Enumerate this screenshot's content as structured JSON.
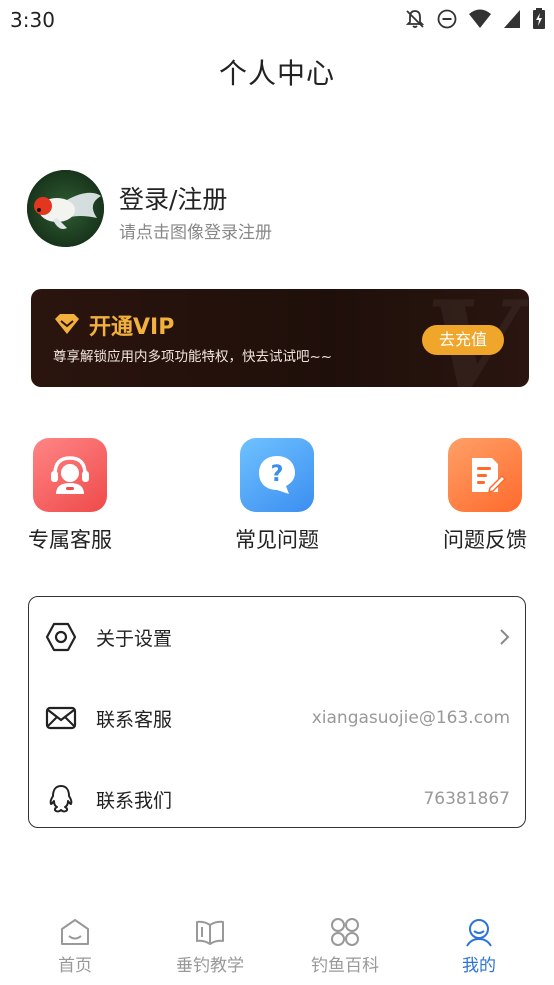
{
  "status_bar": {
    "time": "3:30"
  },
  "header": {
    "title": "个人中心"
  },
  "profile": {
    "login_title": "登录/注册",
    "login_subtitle": "请点击图像登录注册"
  },
  "vip": {
    "title": "开通VIP",
    "description": "尊享解锁应用内多项功能特权，快去试试吧~~",
    "button_label": "去充值",
    "accent_color": "#f2b13d"
  },
  "actions": [
    {
      "label": "专属客服",
      "icon": "customer-service-icon"
    },
    {
      "label": "常见问题",
      "icon": "faq-icon"
    },
    {
      "label": "问题反馈",
      "icon": "feedback-icon"
    }
  ],
  "settings": {
    "about": {
      "label": "关于设置",
      "icon": "hexagon-settings-icon"
    },
    "contact_service": {
      "label": "联系客服",
      "value": "xiangasuojie@163.com",
      "icon": "mail-icon"
    },
    "contact_us": {
      "label": "联系我们",
      "value": "76381867",
      "icon": "qq-icon"
    }
  },
  "bottom_nav": {
    "items": [
      {
        "label": "首页",
        "icon": "home-icon",
        "active": false
      },
      {
        "label": "垂钓教学",
        "icon": "book-icon",
        "active": false
      },
      {
        "label": "钓鱼百科",
        "icon": "grid-icon",
        "active": false
      },
      {
        "label": "我的",
        "icon": "profile-icon",
        "active": true
      }
    ],
    "active_color": "#2e73d8"
  }
}
